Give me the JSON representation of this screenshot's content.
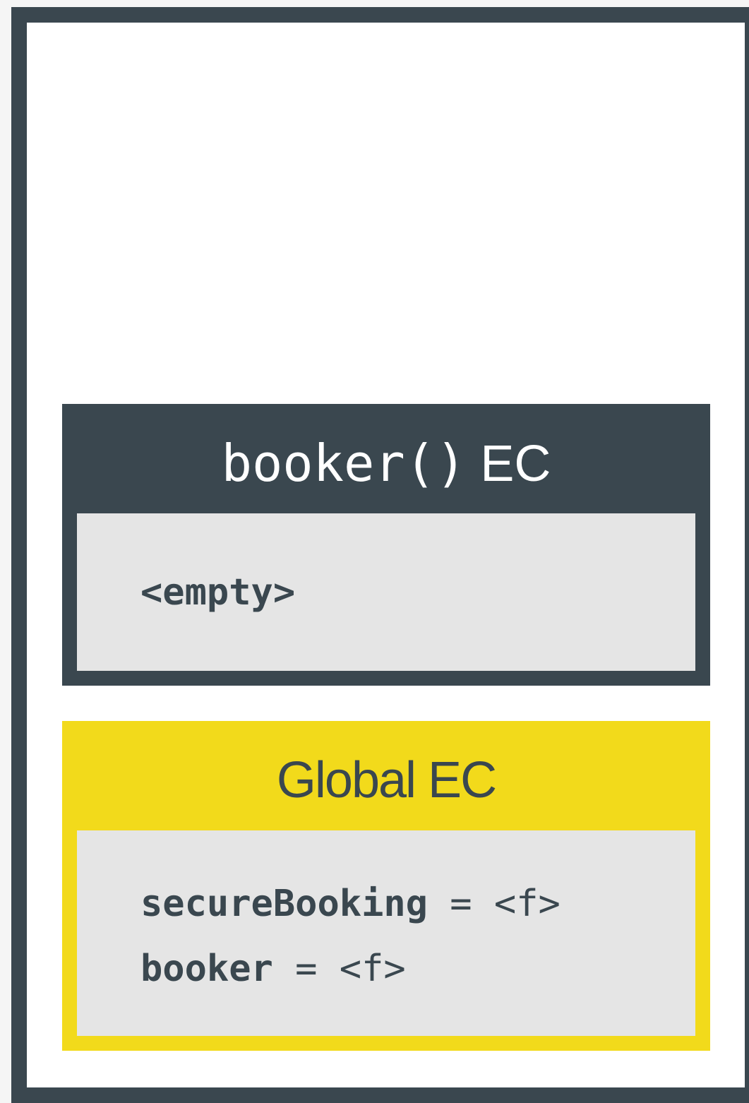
{
  "booker_ec": {
    "title_fn": "booker()",
    "title_suffix": " EC",
    "variables": [
      {
        "text": "<empty>"
      }
    ]
  },
  "global_ec": {
    "title": "Global EC",
    "variables": [
      {
        "name": "secureBooking",
        "value": " = <f>"
      },
      {
        "name": "booker",
        "value": " = <f>"
      }
    ]
  },
  "colors": {
    "frame": "#3a474f",
    "global_accent": "#f2da1b",
    "variable_bg": "#e5e5e5"
  }
}
